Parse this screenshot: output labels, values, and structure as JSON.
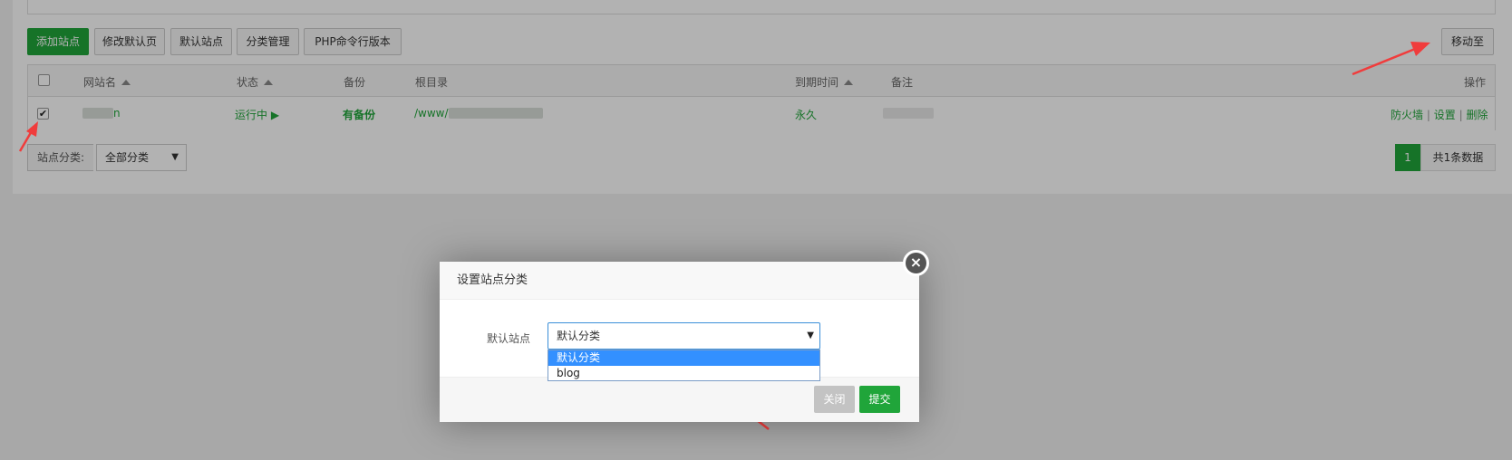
{
  "toolbar": {
    "add_site": "添加站点",
    "edit_default_page": "修改默认页",
    "default_site": "默认站点",
    "category_manage": "分类管理",
    "php_cli_version": "PHP命令行版本",
    "move_to": "移动至"
  },
  "table": {
    "columns": [
      "网站名",
      "状态",
      "备份",
      "根目录",
      "到期时间",
      "备注",
      "操作"
    ],
    "rows": [
      {
        "site_name_visible": "n",
        "status": "运行中",
        "status_icon": "play-icon",
        "backup": "有备份",
        "root_prefix": "/www/",
        "expire": "永久",
        "actions": [
          "防火墙",
          "设置",
          "删除"
        ],
        "separator": "|",
        "checked": true
      }
    ]
  },
  "footer": {
    "category_label": "站点分类:",
    "category_value": "全部分类",
    "page_current": "1",
    "total": "共1条数据"
  },
  "modal": {
    "title": "设置站点分类",
    "field_label": "默认站点",
    "select_value": "默认分类",
    "options": [
      "默认分类",
      "blog"
    ],
    "close_label": "关闭",
    "submit_label": "提交"
  },
  "colors": {
    "accent_green": "#20a53a",
    "annotation_red": "#f03c3c",
    "selected_option": "#3390ff"
  }
}
